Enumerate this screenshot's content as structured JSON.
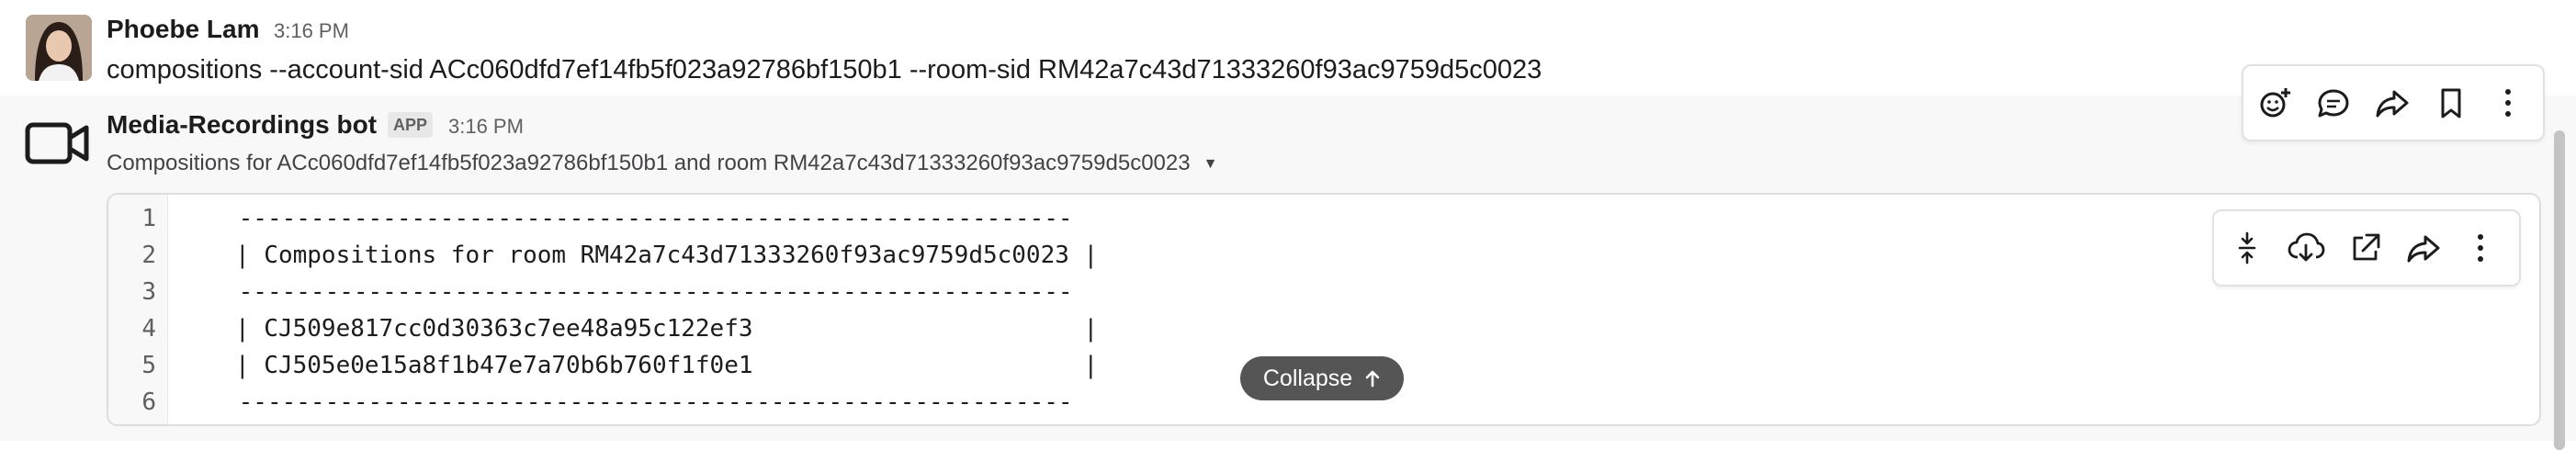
{
  "message1": {
    "author": "Phoebe Lam",
    "time": "3:16 PM",
    "text": "compositions --account-sid ACc060dfd7ef14fb5f023a92786bf150b1 --room-sid RM42a7c43d71333260f93ac9759d5c0023"
  },
  "message2": {
    "author": "Media-Recordings bot",
    "badge": "APP",
    "time": "3:16 PM",
    "subtitle": "Compositions for ACc060dfd7ef14fb5f023a92786bf150b1 and room RM42a7c43d71333260f93ac9759d5c0023",
    "code": {
      "line_numbers": [
        "1",
        "2",
        "3",
        "4",
        "5",
        "6"
      ],
      "lines": [
        " ----------------------------------------------------------",
        "| Compositions for room RM42a7c43d71333260f93ac9759d5c0023 |",
        " ----------------------------------------------------------",
        "| CJ509e817cc0d30363c7ee48a95c122ef3                       |",
        "| CJ505e0e15a8f1b47e7a70b6b760f1f0e1                       |",
        " ----------------------------------------------------------"
      ]
    },
    "collapse_label": "Collapse"
  },
  "message_toolbar": [
    "add-reaction-icon",
    "reply-in-thread-icon",
    "forward-icon",
    "bookmark-icon",
    "more-actions-icon"
  ],
  "snippet_toolbar": [
    "collapse-icon",
    "download-icon",
    "open-external-icon",
    "share-icon",
    "more-options-icon"
  ],
  "colors": {
    "text": "#1d1c1d",
    "muted": "#616061",
    "collapse_bg": "#555555"
  }
}
